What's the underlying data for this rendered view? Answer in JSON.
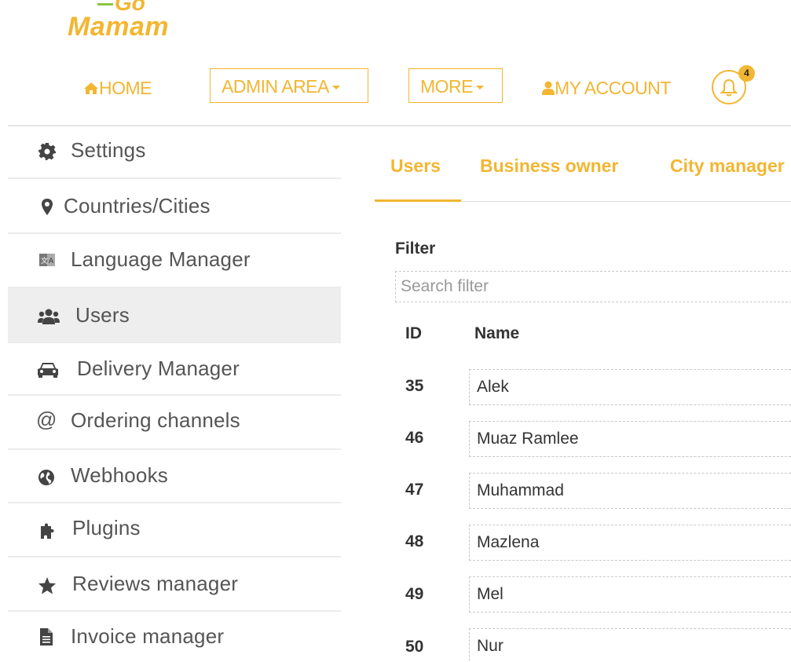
{
  "brand": {
    "logo_top": "Go",
    "logo_main": "Mamam",
    "accent_color": "#f2b632",
    "logo_green": "#8cc63f"
  },
  "nav": {
    "home": "HOME",
    "admin_area": "ADMIN AREA",
    "more": "MORE",
    "my_account": "MY ACCOUNT",
    "notification_count": "4"
  },
  "sidebar": {
    "items": [
      {
        "label": "Settings",
        "icon": "gear-icon"
      },
      {
        "label": "Countries/Cities",
        "icon": "map-marker-icon"
      },
      {
        "label": "Language Manager",
        "icon": "language-icon"
      },
      {
        "label": "Users",
        "icon": "users-icon",
        "active": true
      },
      {
        "label": "Delivery Manager",
        "icon": "car-icon"
      },
      {
        "label": "Ordering channels",
        "icon": "at-icon"
      },
      {
        "label": "Webhooks",
        "icon": "globe-icon"
      },
      {
        "label": "Plugins",
        "icon": "puzzle-icon"
      },
      {
        "label": "Reviews manager",
        "icon": "star-icon"
      },
      {
        "label": "Invoice manager",
        "icon": "file-icon"
      }
    ]
  },
  "main": {
    "tabs": [
      {
        "label": "Users",
        "active": true
      },
      {
        "label": "Business owner"
      },
      {
        "label": "City manager"
      }
    ],
    "filter": {
      "label": "Filter",
      "placeholder": "Search filter",
      "value": ""
    },
    "table": {
      "columns": [
        "ID",
        "Name"
      ],
      "rows": [
        {
          "id": "35",
          "name": "Alek"
        },
        {
          "id": "46",
          "name": "Muaz Ramlee"
        },
        {
          "id": "47",
          "name": "Muhammad"
        },
        {
          "id": "48",
          "name": "Mazlena"
        },
        {
          "id": "49",
          "name": "Mel"
        },
        {
          "id": "50",
          "name": "Nur"
        }
      ]
    }
  }
}
